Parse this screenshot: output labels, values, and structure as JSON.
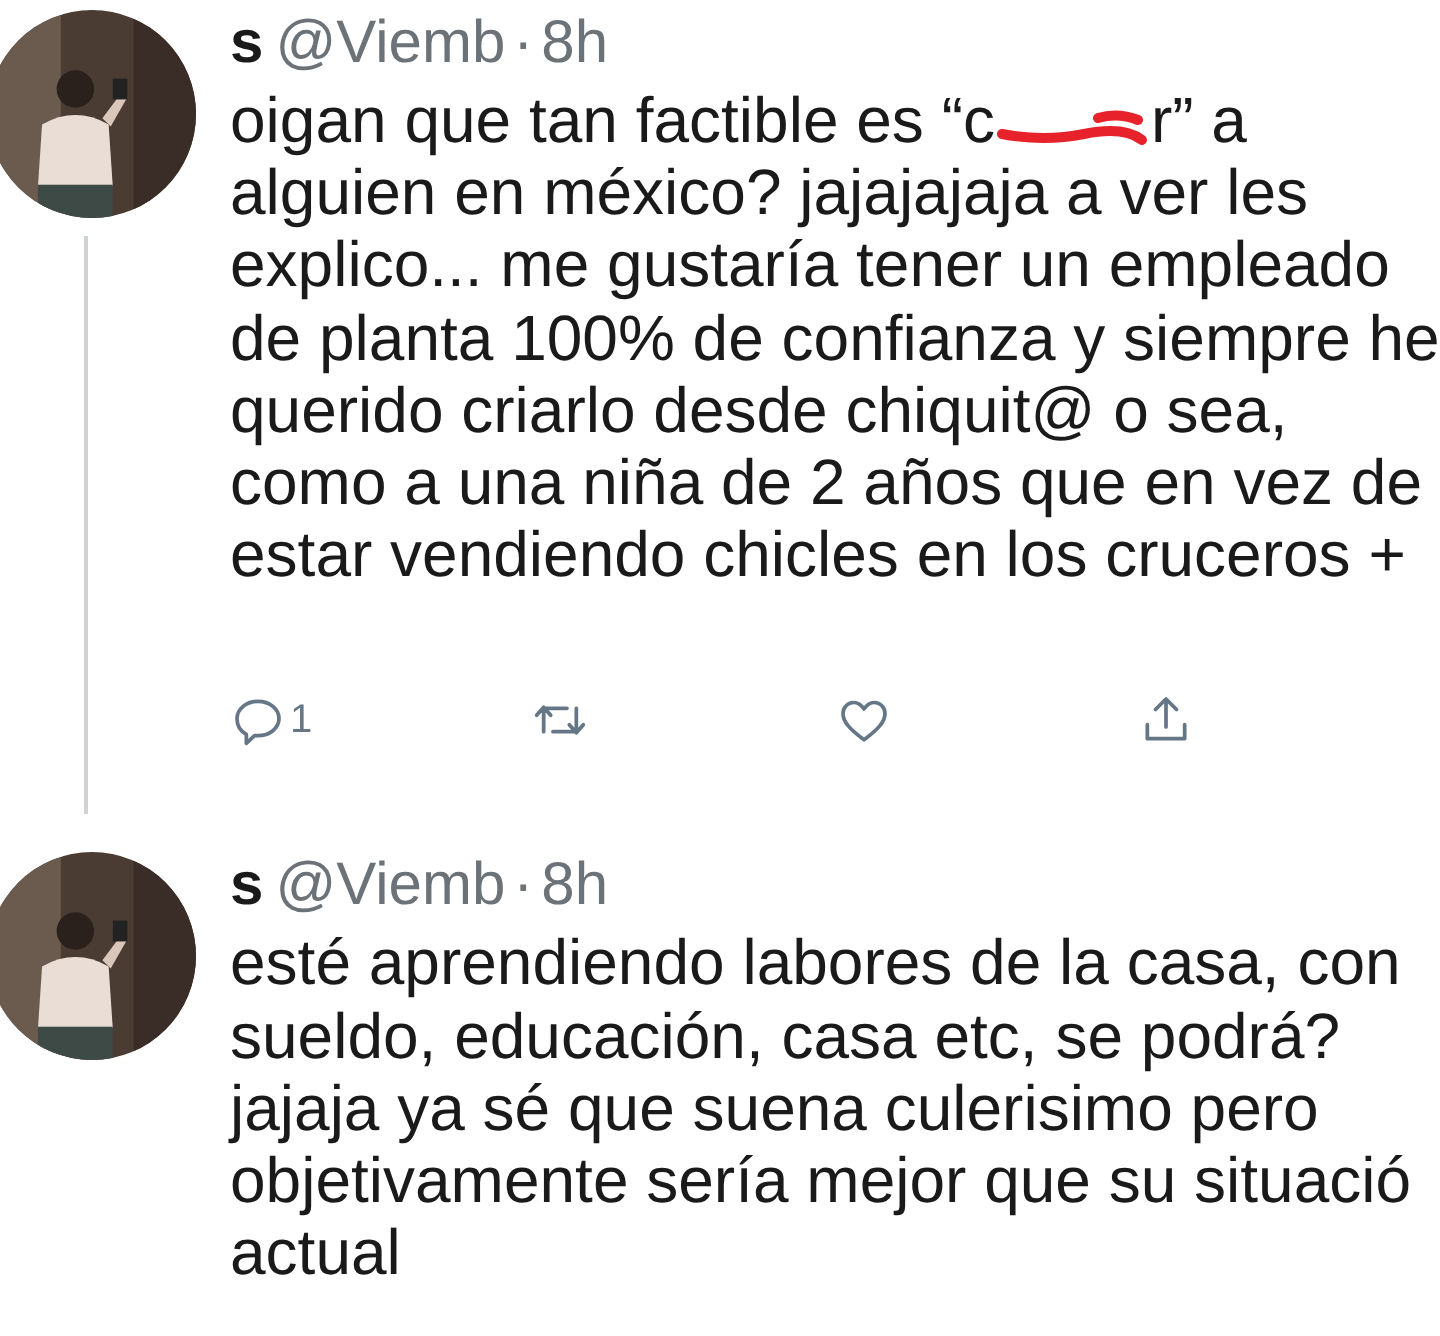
{
  "tweets": [
    {
      "name": "s",
      "handle": "@Viemb",
      "separator": "·",
      "time": "8h",
      "threaded": true,
      "lines": [
        [
          {
            "kind": "text",
            "text": "oigan que tan factible es “c"
          },
          {
            "kind": "scribble"
          },
          {
            "kind": "text",
            "text": "r” a"
          }
        ],
        [
          {
            "kind": "text",
            "text": "alguien en méxico? jajajajaja a ver les"
          }
        ],
        [
          {
            "kind": "text",
            "text": "explico... me gustaría tener un empleado"
          }
        ],
        [
          {
            "kind": "text",
            "text": "de planta 100% de confianza y siempre he"
          }
        ],
        [
          {
            "kind": "text",
            "text": "querido criarlo desde chiquit@ o sea,"
          }
        ],
        [
          {
            "kind": "text",
            "text": "como a una niña de 2 años que en vez de"
          }
        ],
        [
          {
            "kind": "text",
            "text": "estar vendiendo chicles en los cruceros +"
          }
        ]
      ],
      "actions": [
        {
          "kind": "reply",
          "count": "1"
        },
        {
          "kind": "retweet"
        },
        {
          "kind": "like"
        },
        {
          "kind": "share"
        }
      ]
    },
    {
      "name": "s",
      "handle": "@Viemb",
      "separator": "·",
      "time": "8h",
      "threaded": false,
      "lines": [
        [
          {
            "kind": "text",
            "text": "esté aprendiendo labores de la casa, con"
          }
        ],
        [
          {
            "kind": "text",
            "text": "sueldo, educación, casa etc, se podrá?"
          }
        ],
        [
          {
            "kind": "text",
            "text": "jajaja ya sé que suena culerisimo pero"
          }
        ],
        [
          {
            "kind": "text",
            "text": "objetivamente sería mejor que su situació"
          }
        ],
        [
          {
            "kind": "text",
            "text": "actual"
          }
        ]
      ]
    }
  ]
}
